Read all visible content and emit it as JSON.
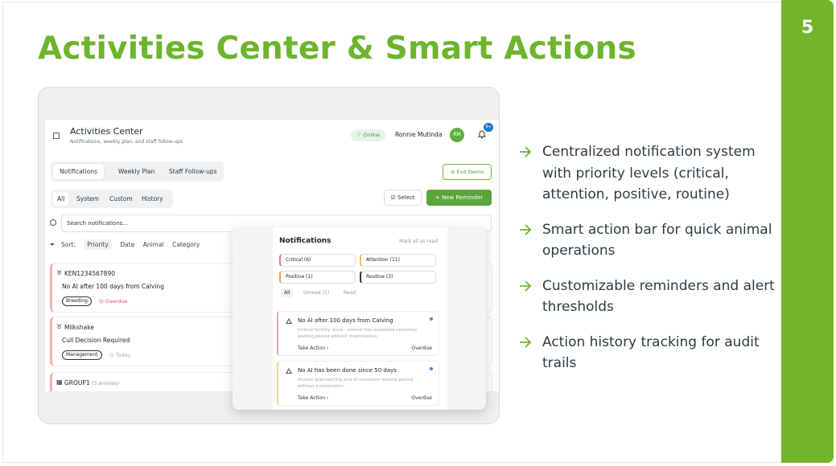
{
  "slide": {
    "title": "Activities Center & Smart Actions",
    "page_number": "5",
    "accent_color": "#72b42a"
  },
  "app": {
    "header": {
      "title": "Activities Center",
      "subtitle": "Notifications, weekly plan, and staff follow-ups",
      "status": "Online",
      "user_name": "Ronnie Mutinda",
      "avatar_initials": "RM",
      "notification_badge": "9+"
    },
    "tabs": [
      "Notifications",
      "Weekly Plan",
      "Staff Follow-ups"
    ],
    "exit_demo_label": "Exit Demo",
    "filters": [
      "All",
      "System",
      "Custom",
      "History"
    ],
    "select_label": "Select",
    "new_reminder_label": "+ New Reminder",
    "search_placeholder": "Search notifications...",
    "sort": {
      "label": "Sort:",
      "options": [
        "Priority",
        "Date",
        "Animal",
        "Category"
      ]
    },
    "cards": [
      {
        "id": "KEN1234567890",
        "text": "No AI after 100 days from Calving",
        "tag": "Breeding",
        "status": "Overdue"
      },
      {
        "id": "Milkshake",
        "text": "Cull Decision Required",
        "tag": "Management",
        "status": "Today"
      },
      {
        "id": "GROUP1",
        "sub": "(3 animals)"
      }
    ]
  },
  "popup": {
    "title": "Notifications",
    "mark_all": "Mark all as read",
    "categories": [
      "Critical (6)",
      "Attention (11)",
      "Positive (1)",
      "Routine (3)"
    ],
    "tabs": [
      "All",
      "Unread (5)",
      "Read"
    ],
    "items": [
      {
        "title": "No AI after 100 days from Calving",
        "desc": "Critical fertility issue - animal has exceeded voluntary waiting period without insemination",
        "action": "Take Action ›",
        "status": "Overdue"
      },
      {
        "title": "No AI has been done since 50 days",
        "desc": "Animal approaching end of voluntary waiting period without insemination",
        "action": "Take Action ›",
        "status": "Overdue"
      }
    ]
  },
  "bullets": [
    "Centralized notification system with priority levels (critical, attention, positive, routine)",
    "Smart action bar for quick animal operations",
    "Customizable reminders and alert thresholds",
    "Action history tracking for audit trails"
  ]
}
